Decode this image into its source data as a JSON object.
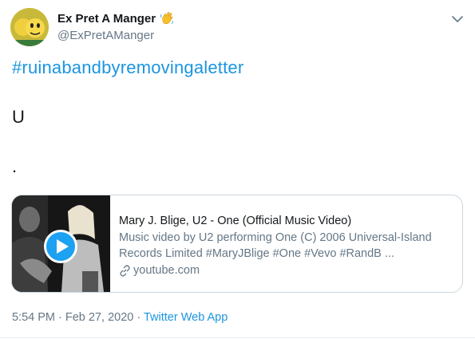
{
  "author": {
    "display_name": "Ex Pret A Manger",
    "display_name_icon": "waving-hand-icon",
    "handle": "@ExPretAManger",
    "avatar_icon": "avatar-image"
  },
  "menu_icon": "chevron-down-icon",
  "tweet": {
    "hashtag": "#ruinabandbyremovingaletter",
    "line1": "U",
    "line2": "."
  },
  "card": {
    "thumbnail_icon": "video-thumbnail",
    "play_icon": "play-icon",
    "title": "Mary J. Blige, U2 - One (Official Music Video)",
    "description": "Music video by U2 performing One (C) 2006 Universal-Island Records Limited #MaryJBlige #One #Vevo #RandB ...",
    "domain_icon": "link-icon",
    "domain": "youtube.com"
  },
  "meta": {
    "time": "5:54 PM",
    "separator1": " · ",
    "date": "Feb 27, 2020",
    "separator2": " · ",
    "source": "Twitter Web App"
  },
  "colors": {
    "link": "#1b95e0",
    "secondary_text": "#657786",
    "play_button": "#1da1f2",
    "card_border": "#ccd6dd"
  }
}
